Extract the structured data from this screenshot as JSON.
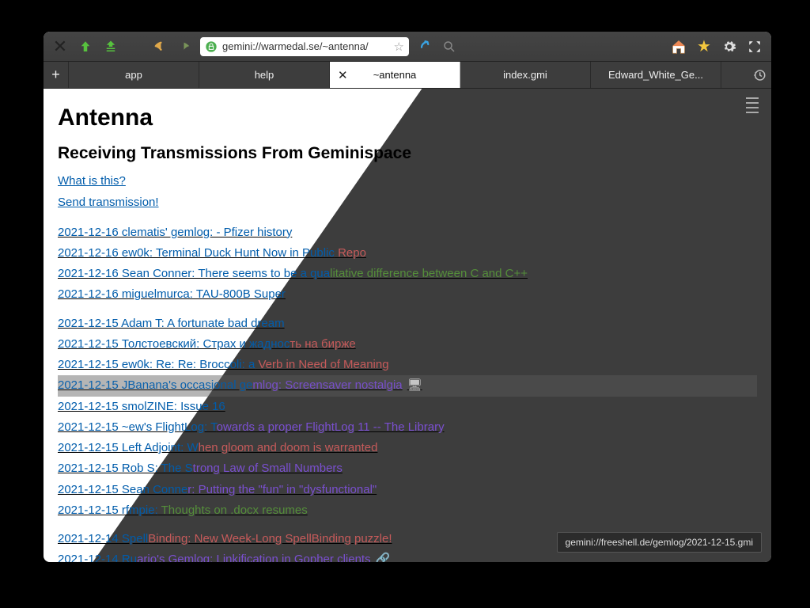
{
  "toolbar": {
    "url": "gemini://warmedal.se/~antenna/"
  },
  "tabs": {
    "t1": "app",
    "t2": "help",
    "t3": "~antenna",
    "t4": "index.gmi",
    "t5": "Edward_White_Ge..."
  },
  "page": {
    "title": "Antenna",
    "subtitle": "Receiving Transmissions From Geminispace",
    "link_what": "What is this?",
    "link_send": "Send transmission!"
  },
  "entries": [
    {
      "date": "2021-12-16",
      "text": " clematis' gemlog: - Pfizer history"
    },
    {
      "date": "2021-12-16",
      "text": " ew0k: Terminal Duck Hunt Now in Public Repo"
    },
    {
      "date": "2021-12-16",
      "text": " Sean Conner: There seems to be a qualitative difference between C and C++"
    },
    {
      "date": "2021-12-16",
      "text": " miguelmurca: TAU-800B Super"
    },
    {
      "date": "2021-12-15",
      "text": " Adam T: A fortunate bad dream"
    },
    {
      "date": "2021-12-15",
      "text": " Толстоевский: Страх и жадность на бирже"
    },
    {
      "date": "2021-12-15",
      "text": " ew0k: Re: Re: Broccoli: a Verb in Need of Meaning"
    },
    {
      "date": "2021-12-15",
      "text": " JBanana's occasional gemlog: Screensaver nostalgia",
      "icon": "🖥"
    },
    {
      "date": "2021-12-15",
      "text": " smolZINE: Issue 16"
    },
    {
      "date": "2021-12-15",
      "text": " ~ew's FlightLog: Towards a proper FlightLog 11 -- The Library"
    },
    {
      "date": "2021-12-15",
      "text": " Left Adjoint: When gloom and doom is warranted"
    },
    {
      "date": "2021-12-15",
      "text": " Rob S: The Strong Law of Small Numbers"
    },
    {
      "date": "2021-12-15",
      "text": " Sean Conner: Putting the \"fun\" in \"dysfunctional\""
    },
    {
      "date": "2021-12-15",
      "text": " rfmpie: Thoughts on .docx resumes"
    },
    {
      "date": "2021-12-14",
      "text": " SpellBinding: New Week-Long SpellBinding puzzle!"
    },
    {
      "date": "2021-12-14",
      "text": " Ruario's Gemlog: Linkification in Gopher clients",
      "icon": "🔗"
    }
  ],
  "tooltip": "gemini://freeshell.de/gemlog/2021-12-15.gmi"
}
